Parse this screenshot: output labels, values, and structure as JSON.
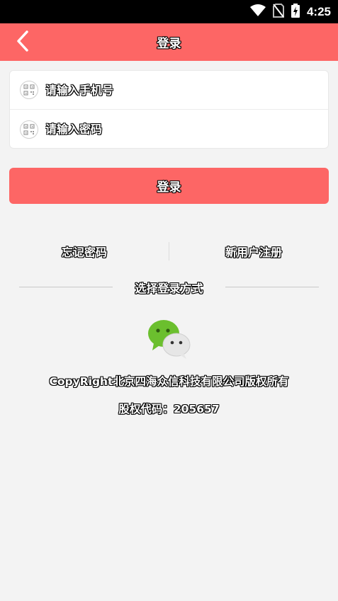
{
  "status_bar": {
    "time": "4:25",
    "icons": [
      "wifi-icon",
      "no-sim-icon",
      "battery-charging-icon"
    ]
  },
  "app_bar": {
    "title": "登录",
    "back_icon": "chevron-left-icon"
  },
  "form": {
    "phone_placeholder": "请输入手机号",
    "password_placeholder": "请输入密码",
    "field_icon": "qr-code-icon"
  },
  "login_button": {
    "label": "登录"
  },
  "links": {
    "forgot_password": "忘记密码",
    "register": "新用户注册"
  },
  "login_method": {
    "label": "选择登录方式",
    "options": [
      "wechat-icon"
    ]
  },
  "footer": {
    "copyright": "CopyRight北京四海众信科技有限公司版权所有",
    "equity_code": "股权代码：205657"
  },
  "colors": {
    "brand": "#fd6665",
    "background": "#f3f3f3",
    "wechat_green": "#6bbf2e"
  }
}
